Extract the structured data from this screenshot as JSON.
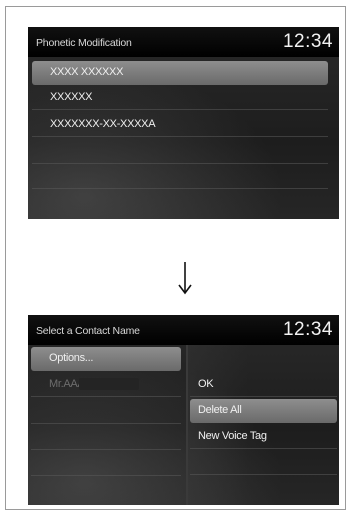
{
  "top_screen": {
    "title": "Phonetic Modification",
    "clock": "12:34",
    "items": [
      {
        "label": "XXXX XXXXXX"
      },
      {
        "label": "XXXXXX"
      },
      {
        "label": "XXXXXXX-XX-XXXXA"
      }
    ]
  },
  "bottom_screen": {
    "title": "Select a Contact Name",
    "clock": "12:34",
    "left_items": [
      {
        "label": "Options..."
      },
      {
        "label": "Mr.AAA"
      }
    ],
    "menu_items": [
      {
        "label": "OK"
      },
      {
        "label": "Delete All"
      },
      {
        "label": "New Voice Tag"
      }
    ]
  }
}
